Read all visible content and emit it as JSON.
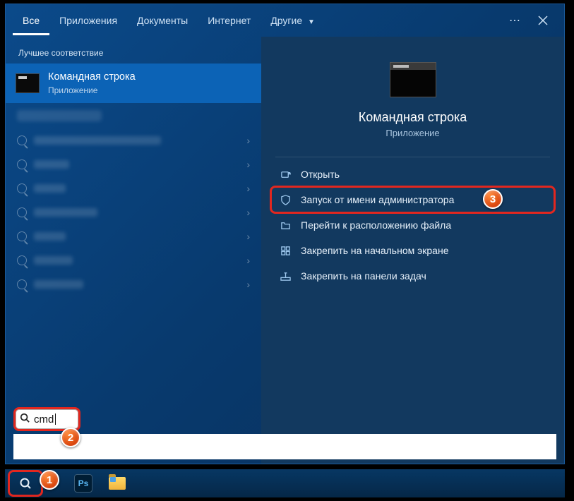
{
  "tabs": {
    "all": "Все",
    "apps": "Приложения",
    "docs": "Документы",
    "web": "Интернет",
    "other": "Другие"
  },
  "section_label": "Лучшее соответствие",
  "top_result": {
    "title": "Командная строка",
    "subtitle": "Приложение"
  },
  "preview": {
    "title": "Командная строка",
    "subtitle": "Приложение"
  },
  "actions": {
    "open": "Открыть",
    "run_admin": "Запуск от имени администратора",
    "open_location": "Перейти к расположению файла",
    "pin_start": "Закрепить на начальном экране",
    "pin_taskbar": "Закрепить на панели задач"
  },
  "search": {
    "value": "cmd"
  },
  "ps_label": "Ps",
  "callouts": {
    "one": "1",
    "two": "2",
    "three": "3"
  }
}
